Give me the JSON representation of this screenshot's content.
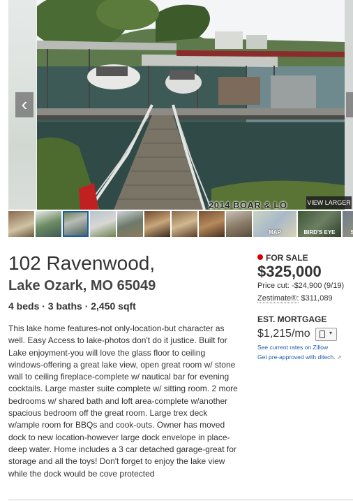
{
  "hero": {
    "watermark": "2014 BOAR & LO",
    "view_larger_label": "VIEW LARGER",
    "prev_arrow": "‹",
    "next_arrow": "›"
  },
  "thumbnails": {
    "photos": [
      "photo-1",
      "photo-2",
      "photo-3",
      "photo-4",
      "photo-5",
      "photo-6",
      "photo-7",
      "photo-8",
      "photo-9"
    ],
    "selected_index": 2,
    "tiles": {
      "map_label": "MAP",
      "birds_eye_label": "BIRD'S EYE",
      "street_label": "STREET V"
    }
  },
  "address": {
    "line1": "102 Ravenwood,",
    "line2": "Lake Ozark, MO 65049"
  },
  "facts": "4 beds · 3 baths · 2,450 sqft",
  "description": "This lake home features-not only-location-but character as well. Easy Access to lake-photos don't do it justice. Built for Lake enjoyment-you will love the glass floor to ceiling windows-offering a great lake view, open great room w/ stone wall to ceiling fireplace-complete w/ nautical bar for evening cocktails. Large master suite complete w/ sitting room. 2 more bedrooms w/ shared bath and loft area-complete w/another spacious bedroom off the great room. Large trex deck w/ample room for BBQs and cook-outs. Owner has moved dock to new location-however large dock envelope in place-deep water. Home includes a 3 car detached garage-great for storage and all the toys! Don't forget to enjoy the lake view while the dock would be cove protected",
  "price_box": {
    "status": "FOR SALE",
    "status_color": "#d40000",
    "price": "$325,000",
    "price_cut": "Price cut: -$24,900 (9/19)",
    "zestimate_label": "Zestimate®:",
    "zestimate_value": "$311,089",
    "mortgage_label": "EST. MORTGAGE",
    "mortgage_value": "$1,215/mo",
    "calculator_icon": "calculator-icon",
    "rates_link": "See current rates on Zillow",
    "preapproved_link": "Get pre-approved with ditech."
  },
  "colors": {
    "link": "#1a5ea8",
    "text": "#333333"
  }
}
